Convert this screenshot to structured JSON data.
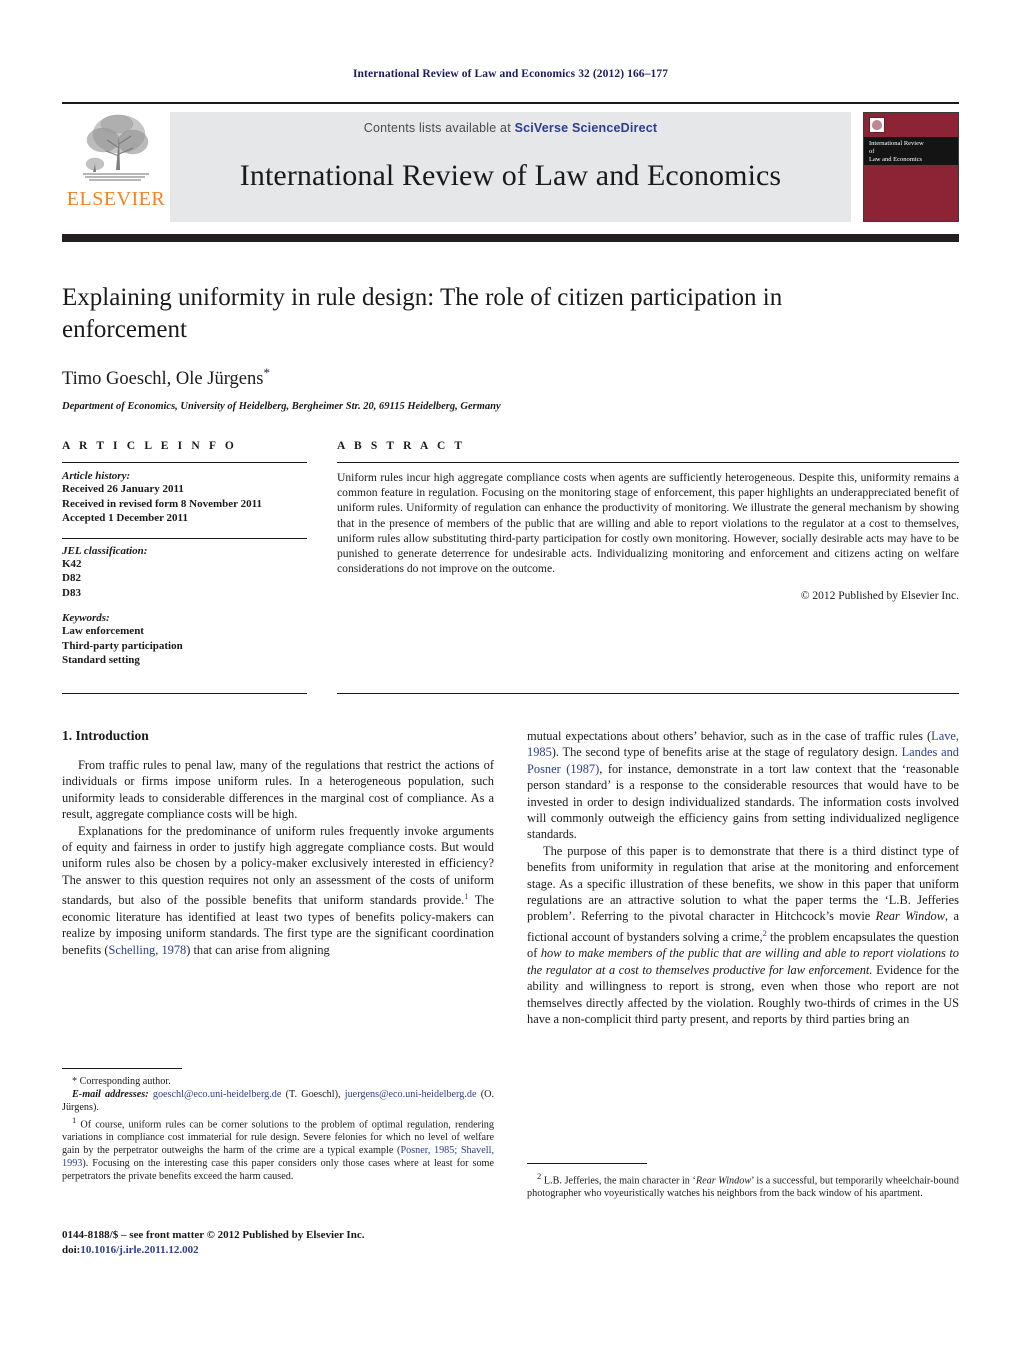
{
  "running_head": "International Review of Law and Economics 32 (2012) 166–177",
  "masthead": {
    "publisher_wordmark": "ELSEVIER",
    "contents_prefix": "Contents lists available at ",
    "sciencedirect_link": "SciVerse ScienceDirect",
    "journal_title": "International Review of Law and Economics",
    "cover": {
      "line1": "International Review",
      "line2": "of",
      "line3": "Law and Economics"
    }
  },
  "article": {
    "title": "Explaining uniformity in rule design: The role of citizen participation in enforcement",
    "authors": "Timo Goeschl, Ole Jürgens",
    "corresponding_marker": "*",
    "affiliation": "Department of Economics, University of Heidelberg, Bergheimer Str. 20, 69115 Heidelberg, Germany"
  },
  "article_info": {
    "heading": "A R T I C L E   I N F O",
    "history_label": "Article history:",
    "history": [
      "Received 26 January 2011",
      "Received in revised form 8 November 2011",
      "Accepted 1 December 2011"
    ],
    "jel_label": "JEL classification:",
    "jel_codes": [
      "K42",
      "D82",
      "D83"
    ],
    "keywords_label": "Keywords:",
    "keywords": [
      "Law enforcement",
      "Third-party participation",
      "Standard setting"
    ]
  },
  "abstract": {
    "heading": "A B S T R A C T",
    "text": "Uniform rules incur high aggregate compliance costs when agents are sufficiently heterogeneous. Despite this, uniformity remains a common feature in regulation. Focusing on the monitoring stage of enforcement, this paper highlights an underappreciated benefit of uniform rules. Uniformity of regulation can enhance the productivity of monitoring. We illustrate the general mechanism by showing that in the presence of members of the public that are willing and able to report violations to the regulator at a cost to themselves, uniform rules allow substituting third-party participation for costly own monitoring. However, socially desirable acts may have to be punished to generate deterrence for undesirable acts. Individualizing monitoring and enforcement and citizens acting on welfare considerations do not improve on the outcome.",
    "copyright": "© 2012 Published by Elsevier Inc."
  },
  "body": {
    "section_title": "1.  Introduction",
    "left_p1_a": "From traffic rules to penal law, many of the regulations that restrict the actions of individuals or firms impose uniform rules. In a heterogeneous population, such uniformity leads to considerable differences in the marginal cost of compliance. As a result, aggregate compliance costs will be high.",
    "left_p2_a": "Explanations for the predominance of uniform rules frequently invoke arguments of equity and fairness in order to justify high aggregate compliance costs. But would uniform rules also be chosen by a policy-maker exclusively interested in efficiency? The answer to this question requires not only an assessment of the costs of uniform standards, but also of the possible benefits that uniform standards provide.",
    "left_p2_fn": "1",
    "left_p2_b": " The economic literature has identified at least two types of benefits policy-makers can realize by imposing uniform standards. The first type are the significant coordination benefits (",
    "left_p2_cite": "Schelling, 1978",
    "left_p2_c": ") that can arise from aligning",
    "right_p1_a": "mutual expectations about others’ behavior, such as in the case of traffic rules (",
    "right_p1_cite1": "Lave, 1985",
    "right_p1_b": "). The second type of benefits arise at the stage of regulatory design. ",
    "right_p1_cite2": "Landes and Posner (1987)",
    "right_p1_c": ", for instance, demonstrate in a tort law context that the ‘reasonable person standard’ is a response to the considerable resources that would have to be invested in order to design individualized standards. The information costs involved will commonly outweigh the efficiency gains from setting individualized negligence standards.",
    "right_p2_a": "The purpose of this paper is to demonstrate that there is a third distinct type of benefits from uniformity in regulation that arise at the monitoring and enforcement stage. As a specific illustration of these benefits, we show in this paper that uniform regulations are an attractive solution to what the paper terms the ‘L.B. Jefferies problem’. Referring to the pivotal character in Hitchcock’s movie ",
    "right_p2_italic1": "Rear Window",
    "right_p2_b": ", a fictional account of bystanders solving a crime,",
    "right_p2_fn": "2",
    "right_p2_c": " the problem encapsulates the question of ",
    "right_p2_italic2": "how to make members of the public that are willing and able to report violations to the regulator at a cost to themselves productive for law enforcement.",
    "right_p2_d": " Evidence for the ability and willingness to report is strong, even when those who report are not themselves directly affected by the violation. Roughly two-thirds of crimes in the US have a non-complicit third party present, and reports by third parties bring an"
  },
  "footnotes": {
    "corresponding": "*  Corresponding author.",
    "email_label": "E-mail addresses:",
    "email1": "goeschl@eco.uni-heidelberg.de",
    "email1_name": " (T. Goeschl),",
    "email2": "juergens@eco.uni-heidelberg.de",
    "email2_name": " (O. Jürgens).",
    "fn1_marker": "1",
    "fn1_a": "  Of course, uniform rules can be corner solutions to the problem of optimal regulation, rendering variations in compliance cost immaterial for rule design. Severe felonies for which no level of welfare gain by the perpetrator outweighs the harm of the crime are a typical example (",
    "fn1_cite": "Posner, 1985; Shavell, 1993",
    "fn1_b": "). Focusing on the interesting case this paper considers only those cases where at least for some perpetrators the private benefits exceed the harm caused.",
    "fn2_marker": "2",
    "fn2_a": "  L.B. Jefferies, the main character in ‘",
    "fn2_italic": "Rear Window",
    "fn2_b": "’ is a successful, but temporarily wheelchair-bound photographer who voyeuristically watches his neighbors from the back window of his apartment."
  },
  "imprint": {
    "issn_line": "0144-8188/$ – see front matter © 2012 Published by Elsevier Inc.",
    "doi_label": "doi:",
    "doi_value": "10.1016/j.irle.2011.12.002"
  }
}
